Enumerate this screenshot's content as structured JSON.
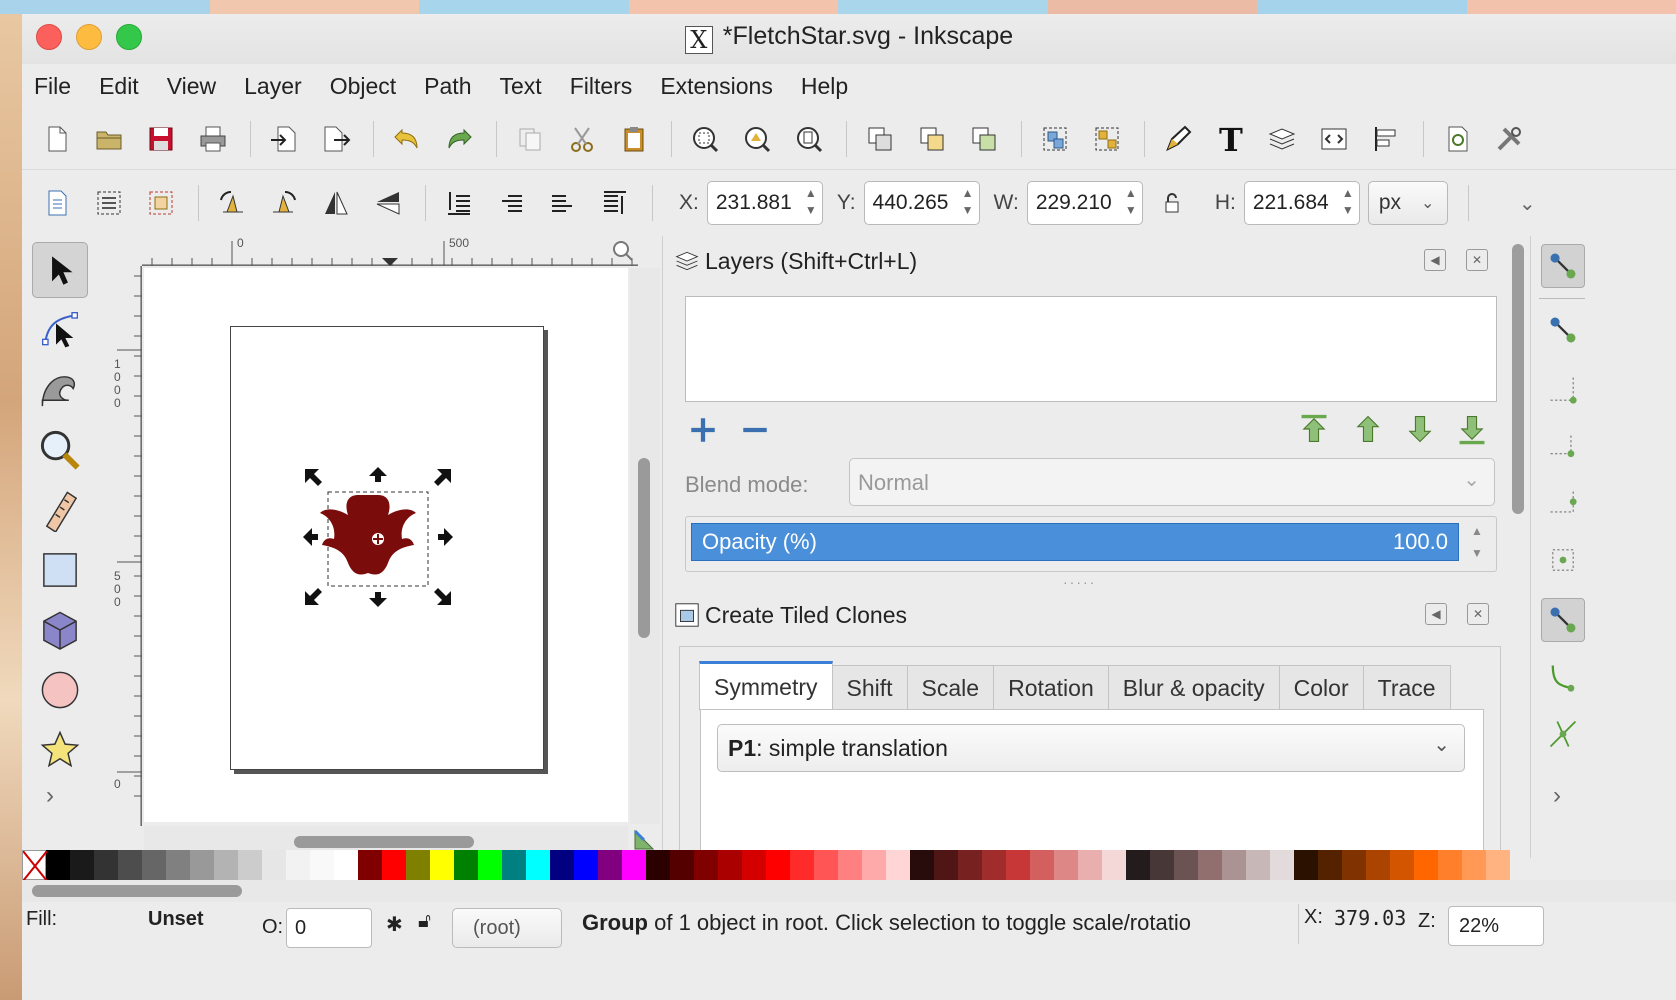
{
  "desktop": {
    "stripe_colors": [
      "#a9d3ea",
      "#f1c7ad",
      "#a6d5ec",
      "#f3c3ac",
      "#a9d6ea",
      "#ecbba5",
      "#a5d3eb",
      "#f2c2ad"
    ]
  },
  "window": {
    "title": "*FletchStar.svg - Inkscape",
    "x_icon": "X"
  },
  "menu": [
    "File",
    "Edit",
    "View",
    "Layer",
    "Object",
    "Path",
    "Text",
    "Filters",
    "Extensions",
    "Help"
  ],
  "coords": {
    "x_label": "X:",
    "x_value": "231.881",
    "y_label": "Y:",
    "y_value": "440.265",
    "w_label": "W:",
    "w_value": "229.210",
    "h_label": "H:",
    "h_value": "221.684",
    "unit": "px"
  },
  "ruler": {
    "h_ticks": [
      "0",
      "500"
    ],
    "v_ticks": [
      "1000",
      "500",
      "0"
    ]
  },
  "layers_panel": {
    "title": "Layers (Shift+Ctrl+L)",
    "blend_label": "Blend mode:",
    "blend_value": "Normal",
    "opacity_label": "Opacity (%)",
    "opacity_value": "100.0"
  },
  "tiled_clones": {
    "title": "Create Tiled Clones",
    "tabs": [
      "Symmetry",
      "Shift",
      "Scale",
      "Rotation",
      "Blur & opacity",
      "Color",
      "Trace"
    ],
    "symmetry_code": "P1",
    "symmetry_text": ": simple translation"
  },
  "palette": [
    "#000000",
    "#1a1a1a",
    "#333333",
    "#4d4d4d",
    "#666666",
    "#808080",
    "#999999",
    "#b3b3b3",
    "#cccccc",
    "#e6e6e6",
    "#f2f2f2",
    "#f9f9f9",
    "#ffffff",
    "#800000",
    "#ff0000",
    "#808000",
    "#ffff00",
    "#008000",
    "#00ff00",
    "#008080",
    "#00ffff",
    "#000080",
    "#0000ff",
    "#800080",
    "#ff00ff",
    "#2b0000",
    "#550000",
    "#800000",
    "#aa0000",
    "#d40000",
    "#ff0000",
    "#ff2a2a",
    "#ff5555",
    "#ff8080",
    "#ffaaaa",
    "#ffd5d5",
    "#280b0b",
    "#501616",
    "#782121",
    "#a02c2c",
    "#c83737",
    "#d35f5f",
    "#de8787",
    "#e9afaf",
    "#f4d7d7",
    "#241c1c",
    "#483737",
    "#6c5353",
    "#916f6f",
    "#ac9393",
    "#c8b7b7",
    "#e3dbdb",
    "#2b1100",
    "#552200",
    "#803300",
    "#aa4400",
    "#d45500",
    "#ff6600",
    "#ff7f2a",
    "#ff9955",
    "#ffb380"
  ],
  "status": {
    "fill_label": "Fill:",
    "fill_value": "Unset",
    "o_label": "O:",
    "o_value": "0",
    "layer_value": "(root)",
    "message_group": "Group",
    "message_rest": " of 1 object in root. Click selection to toggle scale/rotatio",
    "cursor_x_label": "X:",
    "cursor_x": "379.03",
    "zoom_label": "Z:",
    "zoom": "22%"
  }
}
